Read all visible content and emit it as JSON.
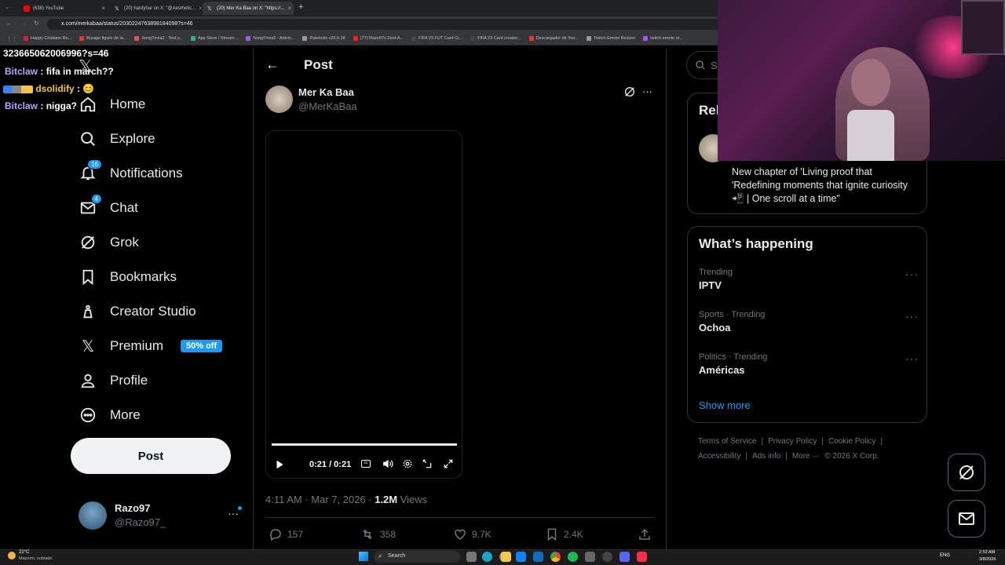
{
  "browser": {
    "tabs": [
      {
        "title": "(638) YouTube",
        "color": "#ff0000"
      },
      {
        "title": "(20) hardyhar on X: \"@Aesthetic...",
        "color": "#e7e9ea"
      },
      {
        "title": "(20) Mer Ka Baa on X: \"https://...",
        "color": "#e7e9ea"
      }
    ],
    "url": "x.com/merkabaa/status/2030224763898184098?s=46",
    "bookmarks": [
      "Happy Cristiano Ro...",
      "Burago figure de la...",
      "SongTrivia2 - Test y...",
      "App Store / Stream...",
      "SongTrivia2 - Adivin...",
      "Paletools v26.0.28",
      "(77) Razo97s Zest-A...",
      "FIFA 23 FUT Card Cr...",
      "FIFA 23 Card creator...",
      "Descargador de You...",
      "Twitch Emote Resizer",
      "twitch emote re..."
    ]
  },
  "chat": {
    "lines": [
      {
        "user": "",
        "text": "3236650620069​96?s=46"
      },
      {
        "user": "Bitclaw",
        "text": "fifa in march??"
      },
      {
        "user": "dsolidify",
        "text": "😊"
      },
      {
        "user": "Bitclaw",
        "text": "nigga?"
      }
    ]
  },
  "sidebar": {
    "items": [
      {
        "label": "Home",
        "icon": "home-icon"
      },
      {
        "label": "Explore",
        "icon": "search-icon"
      },
      {
        "label": "Notifications",
        "icon": "bell-icon",
        "badge": "16"
      },
      {
        "label": "Chat",
        "icon": "mail-icon",
        "badge": "4"
      },
      {
        "label": "Grok",
        "icon": "grok-icon"
      },
      {
        "label": "Bookmarks",
        "icon": "bookmark-icon"
      },
      {
        "label": "Creator Studio",
        "icon": "creator-icon"
      },
      {
        "label": "Premium",
        "icon": "x-logo-icon",
        "badge_text": "50% off"
      },
      {
        "label": "Profile",
        "icon": "person-icon"
      },
      {
        "label": "More",
        "icon": "more-circle-icon"
      }
    ],
    "post_button": "Post",
    "account": {
      "name": "Razo97",
      "handle": "@Razo97_"
    }
  },
  "main": {
    "header": "Post",
    "author": {
      "name": "Mer Ka Baa",
      "handle": "@MerKaBaa"
    },
    "video": {
      "time": "0:21 / 0:21",
      "progress": 1.0
    },
    "meta": {
      "time": "4:11 AM · Mar 7, 2026 · ",
      "views_count": "1.2M",
      "views_label": " Views"
    },
    "actions": {
      "replies": "157",
      "reposts": "358",
      "likes": "9.7K",
      "bookmarks": "2.4K"
    }
  },
  "right": {
    "search_placeholder": "Se",
    "relevant_title": "Rel",
    "relevant_text": "New chapter of 'Living proof that 'Redefining moments that ignite curiosity 📲 | One scroll at a time\"",
    "happening": {
      "title": "What’s happening",
      "trends": [
        {
          "meta": "Trending",
          "name": "IPTV"
        },
        {
          "meta": "Sports · Trending",
          "name": "Ochoa"
        },
        {
          "meta": "Politics · Trending",
          "name": "Américas"
        }
      ],
      "show_more": "Show more"
    },
    "footer": {
      "row1": [
        "Terms of Service",
        "Privacy Policy",
        "Cookie Policy"
      ],
      "row2": [
        "Accessibility",
        "Ads info",
        "More ···",
        "© 2026 X Corp."
      ]
    }
  },
  "taskbar": {
    "weather_temp": "22°C",
    "weather_desc": "Mayorm. nublado",
    "search": "Search",
    "lang": "ENG",
    "time": "2:53 AM",
    "date": "3/8/2026"
  },
  "colors": {
    "accent": "#1d9bf0",
    "bg": "#000000",
    "text": "#e7e9ea",
    "muted": "#71767b"
  }
}
